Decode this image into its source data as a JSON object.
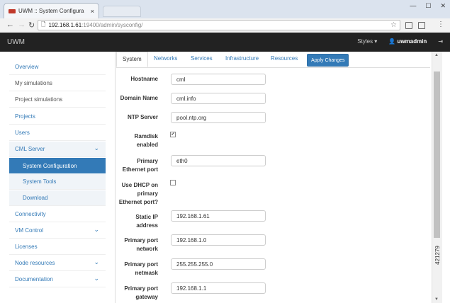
{
  "browser": {
    "tab_title": "UWM :: System Configura",
    "tab_close": "×",
    "url_host": "192.168.1.61",
    "url_path": ":19400/admin/sysconfig/"
  },
  "navbar": {
    "brand": "UWM",
    "styles": "Styles ▾",
    "user": "uwmadmin"
  },
  "sidebar": {
    "overview": "Overview",
    "my_simulations": "My simulations",
    "project_simulations": "Project simulations",
    "projects": "Projects",
    "users": "Users",
    "cml_server": "CML Server",
    "system_configuration": "System Configuration",
    "system_tools": "System Tools",
    "download": "Download",
    "connectivity": "Connectivity",
    "vm_control": "VM Control",
    "licenses": "Licenses",
    "node_resources": "Node resources",
    "documentation": "Documentation"
  },
  "tabs": {
    "system": "System",
    "networks": "Networks",
    "services": "Services",
    "infrastructure": "Infrastructure",
    "resources": "Resources",
    "apply": "Apply Changes"
  },
  "form": {
    "hostname_label": "Hostname",
    "hostname_value": "cml",
    "domain_label": "Domain Name",
    "domain_value": "cml.info",
    "ntp_label": "NTP Server",
    "ntp_value": "pool.ntp.org",
    "ramdisk_label": "Ramdisk enabled",
    "ramdisk_checked": true,
    "primary_eth_label": "Primary Ethernet port",
    "primary_eth_value": "eth0",
    "dhcp_label": "Use DHCP on primary Ethernet port?",
    "dhcp_checked": false,
    "static_ip_label": "Static IP address",
    "static_ip_value": "192.168.1.61",
    "network_label": "Primary port network",
    "network_value": "192.168.1.0",
    "netmask_label": "Primary port netmask",
    "netmask_value": "255.255.255.0",
    "gateway_label": "Primary port gateway",
    "gateway_value": "192.168.1.1"
  },
  "figure_id": "421279"
}
